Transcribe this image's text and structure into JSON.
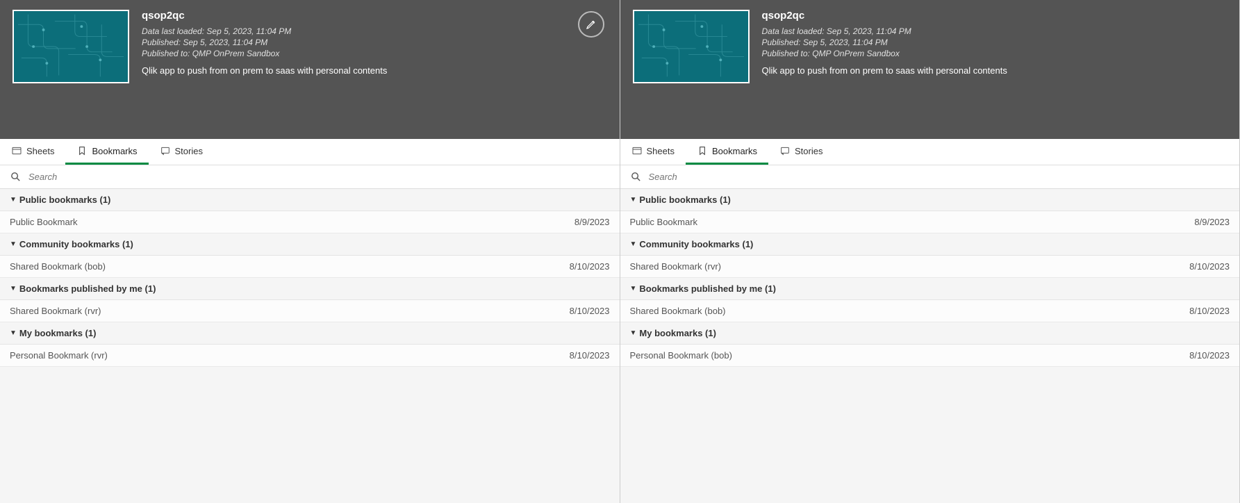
{
  "panes": [
    {
      "app": {
        "title": "qsop2qc",
        "loaded": "Data last loaded: Sep 5, 2023, 11:04 PM",
        "published": "Published: Sep 5, 2023, 11:04 PM",
        "published_to": "Published to: QMP OnPrem Sandbox",
        "desc": "Qlik app to push from on prem to saas with personal contents"
      },
      "show_edit": true,
      "tabs": {
        "sheets": "Sheets",
        "bookmarks": "Bookmarks",
        "stories": "Stories"
      },
      "search": {
        "placeholder": "Search"
      },
      "sections": [
        {
          "header": "Public bookmarks (1)",
          "rows": [
            {
              "name": "Public Bookmark",
              "date": "8/9/2023"
            }
          ]
        },
        {
          "header": "Community bookmarks (1)",
          "rows": [
            {
              "name": "Shared Bookmark (bob)",
              "date": "8/10/2023"
            }
          ]
        },
        {
          "header": "Bookmarks published by me (1)",
          "rows": [
            {
              "name": "Shared Bookmark (rvr)",
              "date": "8/10/2023"
            }
          ]
        },
        {
          "header": "My bookmarks (1)",
          "rows": [
            {
              "name": "Personal Bookmark (rvr)",
              "date": "8/10/2023"
            }
          ]
        }
      ]
    },
    {
      "app": {
        "title": "qsop2qc",
        "loaded": "Data last loaded: Sep 5, 2023, 11:04 PM",
        "published": "Published: Sep 5, 2023, 11:04 PM",
        "published_to": "Published to: QMP OnPrem Sandbox",
        "desc": "Qlik app to push from on prem to saas with personal contents"
      },
      "show_edit": false,
      "tabs": {
        "sheets": "Sheets",
        "bookmarks": "Bookmarks",
        "stories": "Stories"
      },
      "search": {
        "placeholder": "Search"
      },
      "sections": [
        {
          "header": "Public bookmarks (1)",
          "rows": [
            {
              "name": "Public Bookmark",
              "date": "8/9/2023"
            }
          ]
        },
        {
          "header": "Community bookmarks (1)",
          "rows": [
            {
              "name": "Shared Bookmark (rvr)",
              "date": "8/10/2023"
            }
          ]
        },
        {
          "header": "Bookmarks published by me (1)",
          "rows": [
            {
              "name": "Shared Bookmark (bob)",
              "date": "8/10/2023"
            }
          ]
        },
        {
          "header": "My bookmarks (1)",
          "rows": [
            {
              "name": "Personal Bookmark (bob)",
              "date": "8/10/2023"
            }
          ]
        }
      ]
    }
  ]
}
